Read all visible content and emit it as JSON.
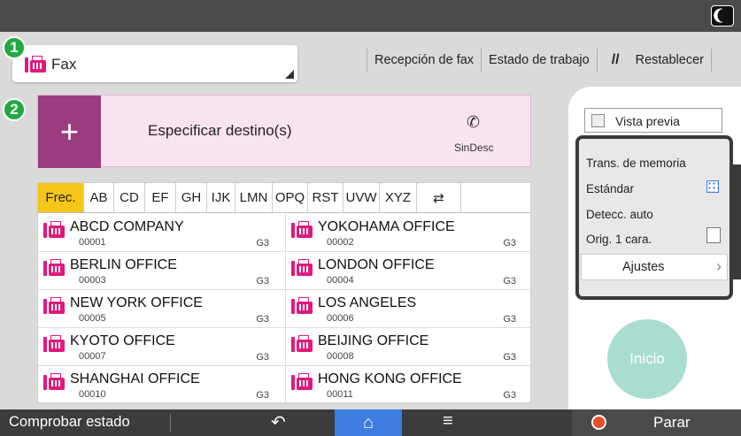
{
  "top": {
    "theme_toggle_icon": "moon-icon"
  },
  "function_select": {
    "label": "Fax"
  },
  "badges": [
    "1",
    "2"
  ],
  "nav": {
    "reception": "Recepción de fax",
    "job_status": "Estado de trabajo",
    "reset": "Restablecer",
    "reset_icon": "double-slash"
  },
  "destination": {
    "plus": "+",
    "label": "Especificar destino(s)",
    "phone_icon": "✆",
    "sub": "SinDesc"
  },
  "tabs": [
    {
      "label": "Frec.",
      "active": true
    },
    {
      "label": "AB"
    },
    {
      "label": "CD"
    },
    {
      "label": "EF"
    },
    {
      "label": "GH"
    },
    {
      "label": "IJK"
    },
    {
      "label": "LMN"
    },
    {
      "label": "OPQ"
    },
    {
      "label": "RST"
    },
    {
      "label": "UVW"
    },
    {
      "label": "XYZ"
    },
    {
      "label": "⇄"
    }
  ],
  "entries": [
    {
      "name": "ABCD COMPANY",
      "num": "00001",
      "type": "G3"
    },
    {
      "name": "YOKOHAMA OFFICE",
      "num": "00002",
      "type": "G3"
    },
    {
      "name": "BERLIN OFFICE",
      "num": "00003",
      "type": "G3"
    },
    {
      "name": "LONDON OFFICE",
      "num": "00004",
      "type": "G3"
    },
    {
      "name": "NEW YORK OFFICE",
      "num": "00005",
      "type": "G3"
    },
    {
      "name": "LOS ANGELES",
      "num": "00006",
      "type": "G3"
    },
    {
      "name": "KYOTO OFFICE",
      "num": "00007",
      "type": "G3"
    },
    {
      "name": "BEIJING OFFICE",
      "num": "00008",
      "type": "G3"
    },
    {
      "name": "SHANGHAI  OFFICE",
      "num": "00010",
      "type": "G3"
    },
    {
      "name": "HONG KONG OFFICE",
      "num": "00011",
      "type": "G3"
    }
  ],
  "preview": {
    "label": "Vista previa"
  },
  "settings": {
    "transmission": "Trans. de memoria",
    "resolution": "Estándar",
    "density": "Detecc. auto",
    "original": "Orig. 1 cara.",
    "adjust": "Ajustes"
  },
  "start": {
    "label": "Inicio"
  },
  "bottom": {
    "check_status": "Comprobar estado",
    "back": "↶",
    "home": "⌂",
    "menu": "≡",
    "stop": "Parar"
  },
  "colors": {
    "accent_fax": "#e0197d",
    "tab_active": "#f5c518",
    "start_button": "#a9ddcf",
    "home_button": "#3d7ce0",
    "badge_green": "#23a844"
  }
}
